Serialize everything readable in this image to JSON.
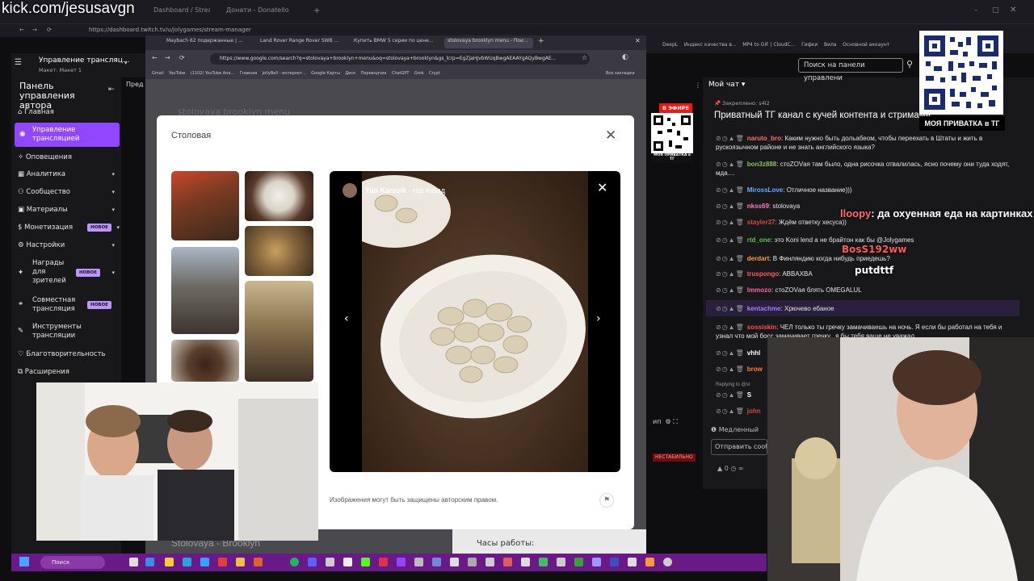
{
  "watermark": "kick.com/jesusavgn",
  "outer_browser": {
    "tabs": [
      "Dashboard / StreamElab",
      "Донати - Donatello"
    ],
    "url": "https://dashboard.twitch.tv/u/jolygames/stream-manager",
    "bookmarks": [
      "DeepL",
      "Индекс качества в...",
      "MP4 to GIF | CloudC...",
      "Гифки",
      "Вила",
      "Основной аккаунт"
    ]
  },
  "inner_browser": {
    "tabs": [
      "Maybach 62 подержанные | ...",
      "Land Rover Range Rover SWB ...",
      "Купить BMW 5 серии по цене...",
      "stolovaya brooklyn menu - Пои..."
    ],
    "url": "https://www.google.com/search?q=stolovaya+brooklyn+menu&oq=stolovaya+brooklyn&gs_lcrp=EgZjaHJvbWUqBwgAEAAYgAQyBwgAE...",
    "bookmarks": [
      "Gmail",
      "YouTube",
      "(1102) YouTube Ana...",
      "Главная",
      "JollyBell - интернет...",
      "Google Карты",
      "Диск",
      "Переводчик",
      "ChatGPT",
      "Grok",
      "Crypt",
      "Все закладки"
    ],
    "search_query": "stolovaya brooklyn menu"
  },
  "twitch": {
    "manager_title": "Управление трансляц...",
    "manager_sub": "Макет: Макет 1",
    "panel_title": "Панель управления автора",
    "preview_label": "Пред",
    "search_placeholder": "Поиск на панели управлени",
    "live_badge": "В ЭФИРЕ",
    "small_qr_label": "МОЯ ПРИВАТКА в ТГ",
    "unstable": "НЕСТАБИЛЬНО",
    "slow_mode": "Медленный",
    "send_placeholder": "Отправить сооб",
    "points": "0",
    "sidebar": [
      {
        "label": "Главная"
      },
      {
        "label": "Управление трансляцией",
        "active": true
      },
      {
        "label": "Оповещения"
      },
      {
        "label": "Аналитика",
        "chevron": true
      },
      {
        "label": "Сообщество",
        "chevron": true
      },
      {
        "label": "Материалы",
        "chevron": true
      },
      {
        "label": "Монетизация",
        "badge": "НОВОЕ",
        "chevron": true
      },
      {
        "label": "Настройки",
        "chevron": true
      },
      {
        "label": "Награды для зрителей",
        "badge": "НОВОЕ",
        "chevron": true
      },
      {
        "label": "Совместная трансляция",
        "badge": "НОВОЕ"
      },
      {
        "label": "Инструменты трансляции"
      },
      {
        "label": "Благотворительность"
      },
      {
        "label": "Расширения"
      }
    ],
    "badge_new": "НОВОЕ"
  },
  "modal": {
    "title": "Столовая",
    "author": "Yan Karasik",
    "time": "· год назад",
    "copyright": "Изображения могут быть защищены авторским правом.",
    "below_title": "Stolovaya - Brooklyn",
    "hours": "Часы работы:"
  },
  "chat": {
    "header": "Мой чат",
    "pinned_label": "Закреплено: s4l2",
    "pinned_text": "Приватный ТГ канал с кучей контента и стримами",
    "messages": [
      {
        "user": "naruto_bro",
        "color": "#ff6b6b",
        "text": "Каким нужно быть дольабеом, чтобы переехать в Штаты и жить в рускоязычном районе и не знать английского языка?"
      },
      {
        "user": "bon3z888",
        "color": "#8fbf5a",
        "text": "стоZOVая там было, одна рисочка отвалилась, ясно почему они туда ходят, мда...."
      },
      {
        "user": "MirossLove",
        "color": "#6fa8ff",
        "text": "Отличное название)))"
      },
      {
        "user": "nkss69",
        "color": "#ff7ab6",
        "text": "stolovaya"
      },
      {
        "user": "stayler37",
        "color": "#d04a4a",
        "text": "Ждём ответку хесуса))"
      },
      {
        "user": "rtd_one",
        "color": "#58c45a",
        "text": "это Koni lend а не брайтон как бы @Jolygames"
      },
      {
        "user": "derdart",
        "color": "#ff9a3c",
        "text": "В Финляндию когда нибудь приедешь?"
      },
      {
        "user": "truspongo",
        "color": "#ff5a5a",
        "text": "ABBAXBA"
      },
      {
        "user": "lmmozo",
        "color": "#ff5fa8",
        "text": "стоZOVая блять OMEGALUL"
      },
      {
        "user": "kentachme",
        "color": "#a77bff",
        "text": "Хрючево ебаное"
      },
      {
        "user": "sossiskin",
        "color": "#ff4f4f",
        "text": "ЧЕЛ только ты гречку замачиваешь на ночь. Я если бы работал на тебя и узнал что мой босс замачивает гречку.. я бы тебя ваще не уважал"
      },
      {
        "user": "vhhl",
        "color": "#ffffff",
        "text": ""
      },
      {
        "user": "brow",
        "color": "#ff7a3c",
        "text": ""
      },
      {
        "user": "Replying to @st",
        "color": "#999999",
        "text": ""
      },
      {
        "user": "S",
        "color": "#ffffff",
        "text": ""
      },
      {
        "user": "john",
        "color": "#d04a4a",
        "text": ""
      }
    ],
    "overlay_user": "lloopy",
    "overlay_text": "да охуенная еда на картинках",
    "overlay_user2": "BosS192ww",
    "overlay_user3": "putdttf"
  },
  "qr_label": "МОЯ ПРИВАТКА в ТГ",
  "taskbar": {
    "search": "Поиск"
  }
}
